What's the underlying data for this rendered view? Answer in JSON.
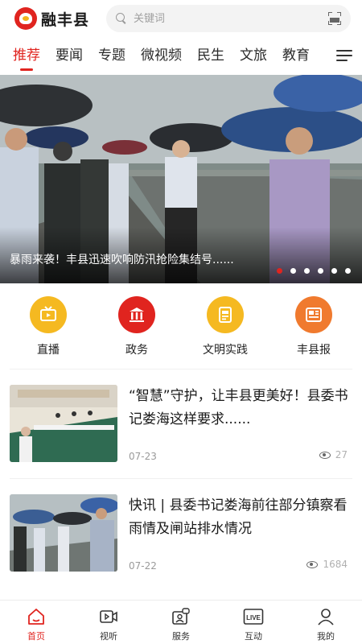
{
  "header": {
    "logo_text": "融丰县",
    "search_placeholder": "关键词"
  },
  "tabs": [
    {
      "label": "推荐",
      "active": true
    },
    {
      "label": "要闻",
      "active": false
    },
    {
      "label": "专题",
      "active": false
    },
    {
      "label": "微视频",
      "active": false
    },
    {
      "label": "民生",
      "active": false
    },
    {
      "label": "文旅",
      "active": false
    },
    {
      "label": "教育",
      "active": false
    }
  ],
  "banner": {
    "caption": "暴雨来袭！丰县迅速吹响防汛抢险集结号......",
    "slide_count": 6,
    "active_slide": 1
  },
  "quick_entries": [
    {
      "label": "直播",
      "icon": "tv-icon",
      "color": "#f5b921"
    },
    {
      "label": "政务",
      "icon": "government-building-icon",
      "color": "#e0241f"
    },
    {
      "label": "文明实践",
      "icon": "document-icon",
      "color": "#f5b921"
    },
    {
      "label": "丰县报",
      "icon": "newspaper-icon",
      "color": "#f07a2e"
    }
  ],
  "news": [
    {
      "title": "“智慧”守护，让丰县更美好！县委书记娄海这样要求......",
      "date": "07-23",
      "views": "27"
    },
    {
      "title": "快讯 | 县委书记娄海前往部分镇察看雨情及闸站排水情况",
      "date": "07-22",
      "views": "1684"
    }
  ],
  "bottom_nav": [
    {
      "label": "首页",
      "icon": "home-icon",
      "active": true
    },
    {
      "label": "视听",
      "icon": "video-icon",
      "active": false
    },
    {
      "label": "服务",
      "icon": "service-icon",
      "active": false
    },
    {
      "label": "互动",
      "icon": "live-icon",
      "active": false
    },
    {
      "label": "我的",
      "icon": "user-icon",
      "active": false
    }
  ],
  "live_icon_text": "LIVE",
  "colors": {
    "accent": "#e0241f",
    "yellow": "#f5b921",
    "orange": "#f07a2e"
  }
}
